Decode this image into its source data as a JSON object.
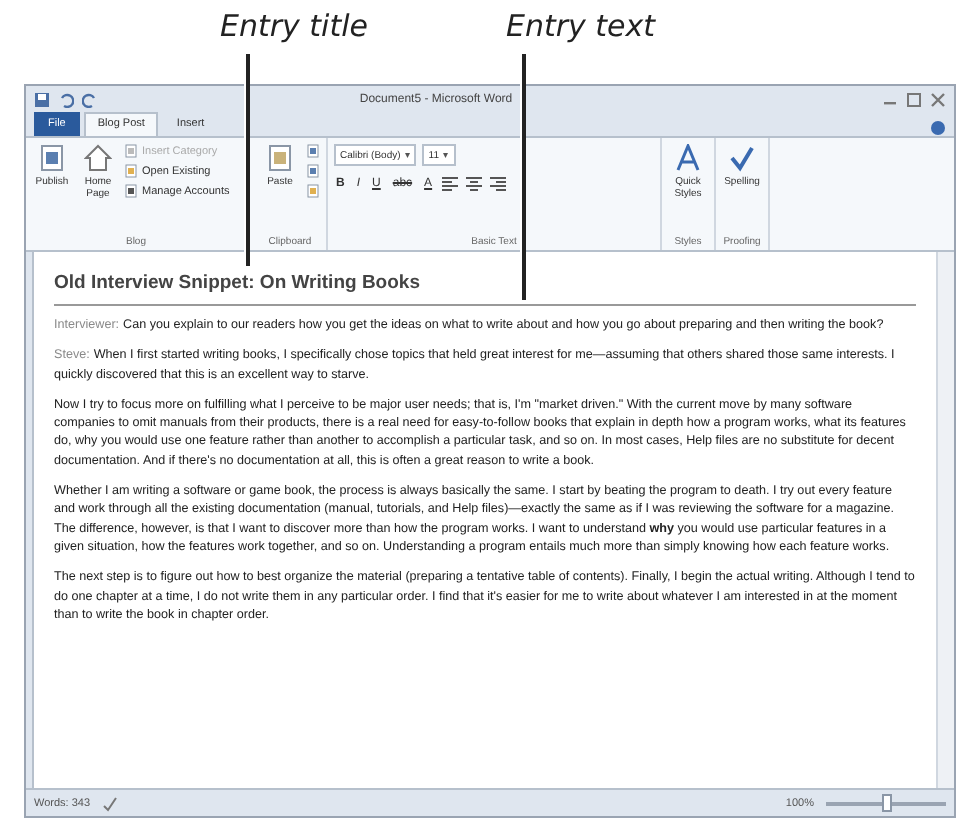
{
  "callouts": [
    {
      "label": "Entry title"
    },
    {
      "label": "Entry text"
    }
  ],
  "window": {
    "title": "Document5 - Microsoft Word"
  },
  "tabs": [
    {
      "label": "File",
      "kind": "file",
      "selected": false
    },
    {
      "label": "Blog Post",
      "kind": "tab",
      "selected": true
    },
    {
      "label": "Insert",
      "kind": "tab",
      "selected": false
    }
  ],
  "ribbon": {
    "blog": {
      "label": "Blog",
      "publish": "Publish",
      "home_page": "Home Page",
      "insert_category": {
        "label": "Insert Category",
        "disabled": true
      },
      "open_existing": "Open Existing",
      "manage_accounts": "Manage Accounts"
    },
    "clipboard": {
      "label": "Clipboard",
      "paste": "Paste"
    },
    "basic_text": {
      "label": "Basic Text",
      "font": "Calibri (Body)",
      "size": "11",
      "bold": "B",
      "italic": "I",
      "underline": "U",
      "strike": "abc",
      "font_color": "A",
      "dropdown": "▾"
    },
    "styles": {
      "label": "Styles",
      "quick_styles": "Quick Styles"
    },
    "proofing": {
      "label": "Proofing",
      "spelling": "Spelling"
    }
  },
  "document": {
    "title": "Old Interview Snippet: On Writing Books",
    "paragraphs": [
      {
        "speaker": "Interviewer:",
        "text": "Can you explain to our readers how you get the ideas on what to write about and how you go about preparing and then writing the book?"
      },
      {
        "speaker": "Steve:",
        "text": "When I first started writing books, I specifically chose topics that held great interest for me—assuming that others shared those same interests. I quickly discovered that this is an excellent way to starve."
      },
      {
        "text": "Now I try to focus more on fulfilling what I perceive to be major user needs; that is, I'm \"market driven.\" With the current move by many software companies to omit manuals from their products, there is a real need for easy-to-follow books that explain in depth how a program works, what its features do, why you would use one feature rather than another to accomplish a particular task, and so on. In most cases, Help files are no substitute for decent documentation. And if there's no documentation at all, this is often a great reason to write a book."
      },
      {
        "text": "Whether I am writing a software or game book, the process is always basically the same. I start by beating the program to death. I try out every feature and work through all the existing documentation (manual, tutorials, and Help files)—exactly the same as if I was reviewing the software for a magazine. The difference, however, is that I want to discover more than how the program works. I want to understand **why** you would use particular features in a given situation, how the features work together, and so on. Understanding a program entails much more than simply knowing how each feature works."
      },
      {
        "text": "The next step is to figure out how to best organize the material (preparing a tentative table of contents). Finally, I begin the actual writing. Although I tend to do one chapter at a time, I do not write them in any particular order. I find that it's easier for me to write about whatever I am interested in at the moment than to write the book in chapter order."
      }
    ]
  },
  "status_bar": {
    "words": "Words: 343",
    "zoom": "100%",
    "zoom_level": {
      "level": 0.5
    }
  }
}
